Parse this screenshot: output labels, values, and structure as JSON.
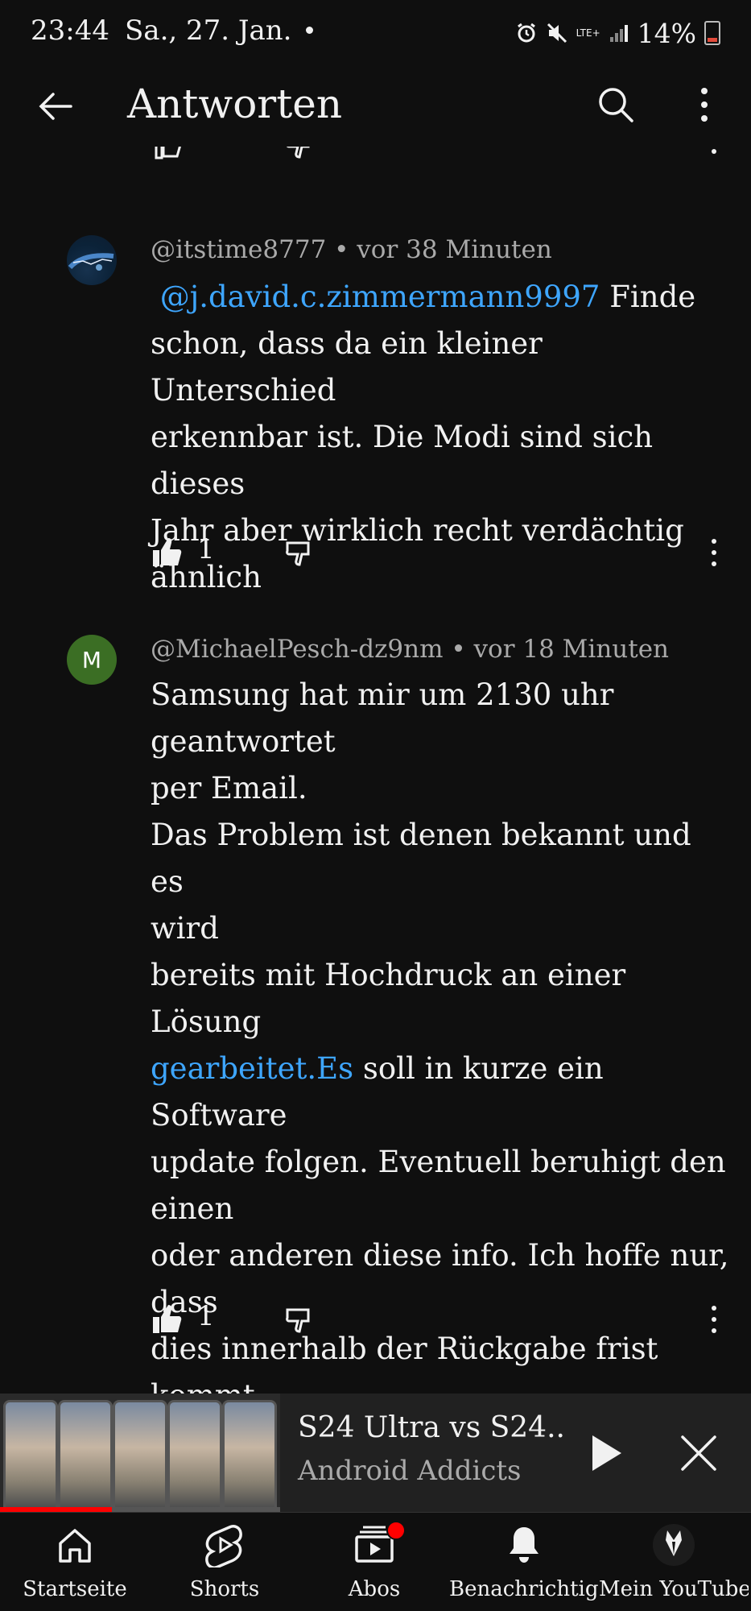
{
  "status_bar": {
    "time": "23:44",
    "date": "Sa., 27. Jan.",
    "network": "LTE+",
    "battery": "14%"
  },
  "header": {
    "title": "Antworten",
    "icons": [
      "back-arrow-icon",
      "search-icon",
      "more-vert-icon"
    ]
  },
  "comments": [
    {
      "author": "@itstime8777",
      "time": "vor 38 Minuten",
      "mention": "@j.david.c.zimmermann9997",
      "text_line1": " Finde",
      "lines": [
        "schon, dass da ein kleiner Unterschied",
        "erkennbar ist. Die Modi sind sich dieses",
        "Jahr aber wirklich recht verdächtig",
        "ähnlich"
      ],
      "likes": "1"
    },
    {
      "author": "@MichaelPesch-dz9nm",
      "avatar_letter": "M",
      "time": "vor 18 Minuten",
      "lines": [
        "Samsung hat mir um 2130 uhr",
        "geantwortet",
        "per Email.",
        "Das Problem ist denen bekannt und es",
        "wird",
        "bereits mit Hochdruck an einer Lösung"
      ],
      "link": "gearbeitet.Es",
      "link_rest": " soll in kurze ein Software",
      "lines_after": [
        "update folgen. Eventuell beruhigt den",
        "einen",
        "oder anderen diese info. Ich hoffe nur,",
        "dass",
        "dies innerhalb der Rückgabe frist",
        "kommt"
      ],
      "likes": "1"
    }
  ],
  "mini_player": {
    "title": "S24 Ultra vs S24..",
    "channel": "Android Addicts",
    "progress": 0.4
  },
  "bottom_nav": {
    "items": [
      {
        "label": "Startseite",
        "icon": "home-icon"
      },
      {
        "label": "Shorts",
        "icon": "shorts-icon"
      },
      {
        "label": "Abos",
        "icon": "subscriptions-icon"
      },
      {
        "label": "Benachrichtig...",
        "icon": "bell-icon"
      },
      {
        "label": "Mein YouTube",
        "icon": "avatar-icon"
      }
    ]
  },
  "colors": {
    "background": "#0f0f0f",
    "text": "#f1f1f1",
    "secondary_text": "#aaaaaa",
    "link": "#3ea6ff",
    "accent": "#ff0000"
  }
}
